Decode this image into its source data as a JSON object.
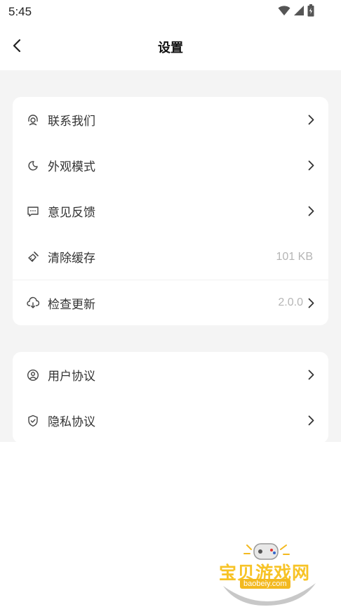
{
  "status_bar": {
    "time": "5:45"
  },
  "nav": {
    "title": "设置"
  },
  "groups": [
    {
      "items": [
        {
          "label": "联系我们",
          "icon": "headset-icon"
        },
        {
          "label": "外观模式",
          "icon": "moon-icon"
        },
        {
          "label": "意见反馈",
          "icon": "feedback-icon"
        },
        {
          "label": "清除缓存",
          "icon": "broom-icon",
          "value": "101 KB"
        },
        {
          "label": "检查更新",
          "icon": "cloud-download-icon",
          "value": "2.0.0"
        }
      ]
    },
    {
      "items": [
        {
          "label": "用户协议",
          "icon": "user-circle-icon"
        },
        {
          "label": "隐私协议",
          "icon": "shield-icon"
        }
      ]
    }
  ],
  "watermark": {
    "text": "宝贝游戏网",
    "url": "baobeiy.com"
  }
}
